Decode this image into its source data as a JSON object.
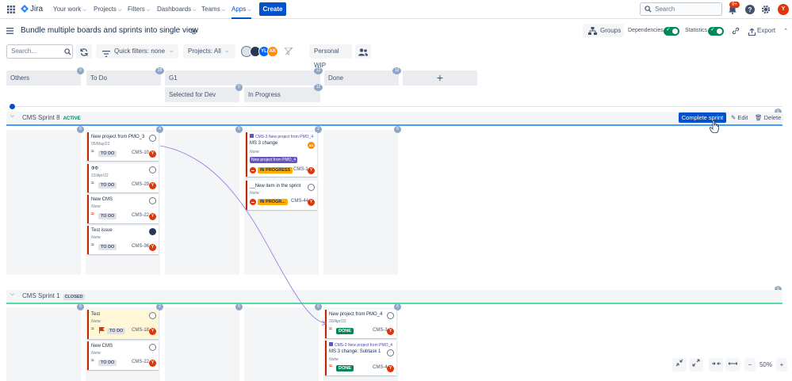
{
  "nav": {
    "logo": "Jira",
    "your_work": "Your work",
    "projects": "Projects",
    "filters": "Filters",
    "dashboards": "Dashboards",
    "teams": "Teams",
    "apps": "Apps",
    "create": "Create",
    "search_placeholder": "Search",
    "notification_count": "9+",
    "avatar_initial": "Y"
  },
  "header": {
    "title": "Bundle multiple boards and sprints into single view",
    "groups": "Groups",
    "dependencies": "Dependencies",
    "statistics": "Statistics",
    "export": "Export"
  },
  "filters": {
    "search_placeholder": "Search...",
    "quick_filters": "Quick filters: none",
    "projects": "Projects: All",
    "avatars": [
      "",
      "",
      "YL",
      "AK"
    ],
    "personal_wip": "Personal WIP"
  },
  "columns": {
    "others": {
      "label": "Others",
      "count": "0"
    },
    "todo": {
      "label": "To Do",
      "count": "28"
    },
    "g1": {
      "label": "G1",
      "count": "12"
    },
    "selected": {
      "label": "Selected for Dev",
      "count": "0"
    },
    "inprogress": {
      "label": "In Progress",
      "count": "12"
    },
    "done": {
      "label": "Done",
      "count": "10"
    },
    "add": "+"
  },
  "sprint8": {
    "name": "CMS Sprint 8",
    "tag": "ACTIVE",
    "count": "6",
    "complete": "Complete sprint",
    "edit": "Edit",
    "delete": "Delete",
    "lane_counts": [
      "0",
      "4",
      "0",
      "2",
      "0"
    ],
    "cards": [
      {
        "title": "New project from PMO_3",
        "date": "05/May/22",
        "status": "TO DO",
        "key": "CMS-10"
      },
      {
        "title": "ФФ",
        "date": "22/Apr/22",
        "status": "TO DO",
        "key": "CMS-29"
      },
      {
        "title": "New CMS",
        "date": "None",
        "status": "TO DO",
        "key": "CMS-22"
      },
      {
        "title": "Test issue",
        "date": "None",
        "status": "TO DO",
        "key": "CMS-36"
      }
    ],
    "prog_cards": [
      {
        "parent": "CMS-3 New project from PMO_4",
        "title": "MS 3 change",
        "sub": "None",
        "epic": "New project from PMO_4",
        "status": "IN PROGRESS",
        "key": "CMS-1",
        "avatar": "AK"
      },
      {
        "title": "__New item in the sprint",
        "sub": "None",
        "status": "IN PROGR...",
        "key": "CMS-44"
      }
    ]
  },
  "sprint1": {
    "name": "CMS Sprint 1",
    "tag": "CLOSED",
    "count": "6",
    "lane_counts": [
      "0",
      "2",
      "0",
      "0",
      "6"
    ],
    "cards": [
      {
        "title": "Test",
        "date": "None",
        "status": "TO DO",
        "key": "CMS-18"
      },
      {
        "title": "New CMS",
        "date": "None",
        "status": "TO DO",
        "key": "CMS-22"
      }
    ],
    "done_cards": [
      {
        "title": "New project from PMO_4",
        "date": "20/Apr/22",
        "status": "DONE",
        "key": "CMS-3"
      },
      {
        "parent": "CMS-3 New project from PMO_4",
        "title": "MS 3 change: Subtask 1",
        "date": "None",
        "status": "DONE",
        "key": "CMS-4"
      }
    ]
  },
  "zoom": {
    "level": "50%",
    "minus": "−",
    "plus": "+"
  },
  "colors": {
    "brand": "#0052cc",
    "danger": "#de350b",
    "success": "#00875a"
  }
}
